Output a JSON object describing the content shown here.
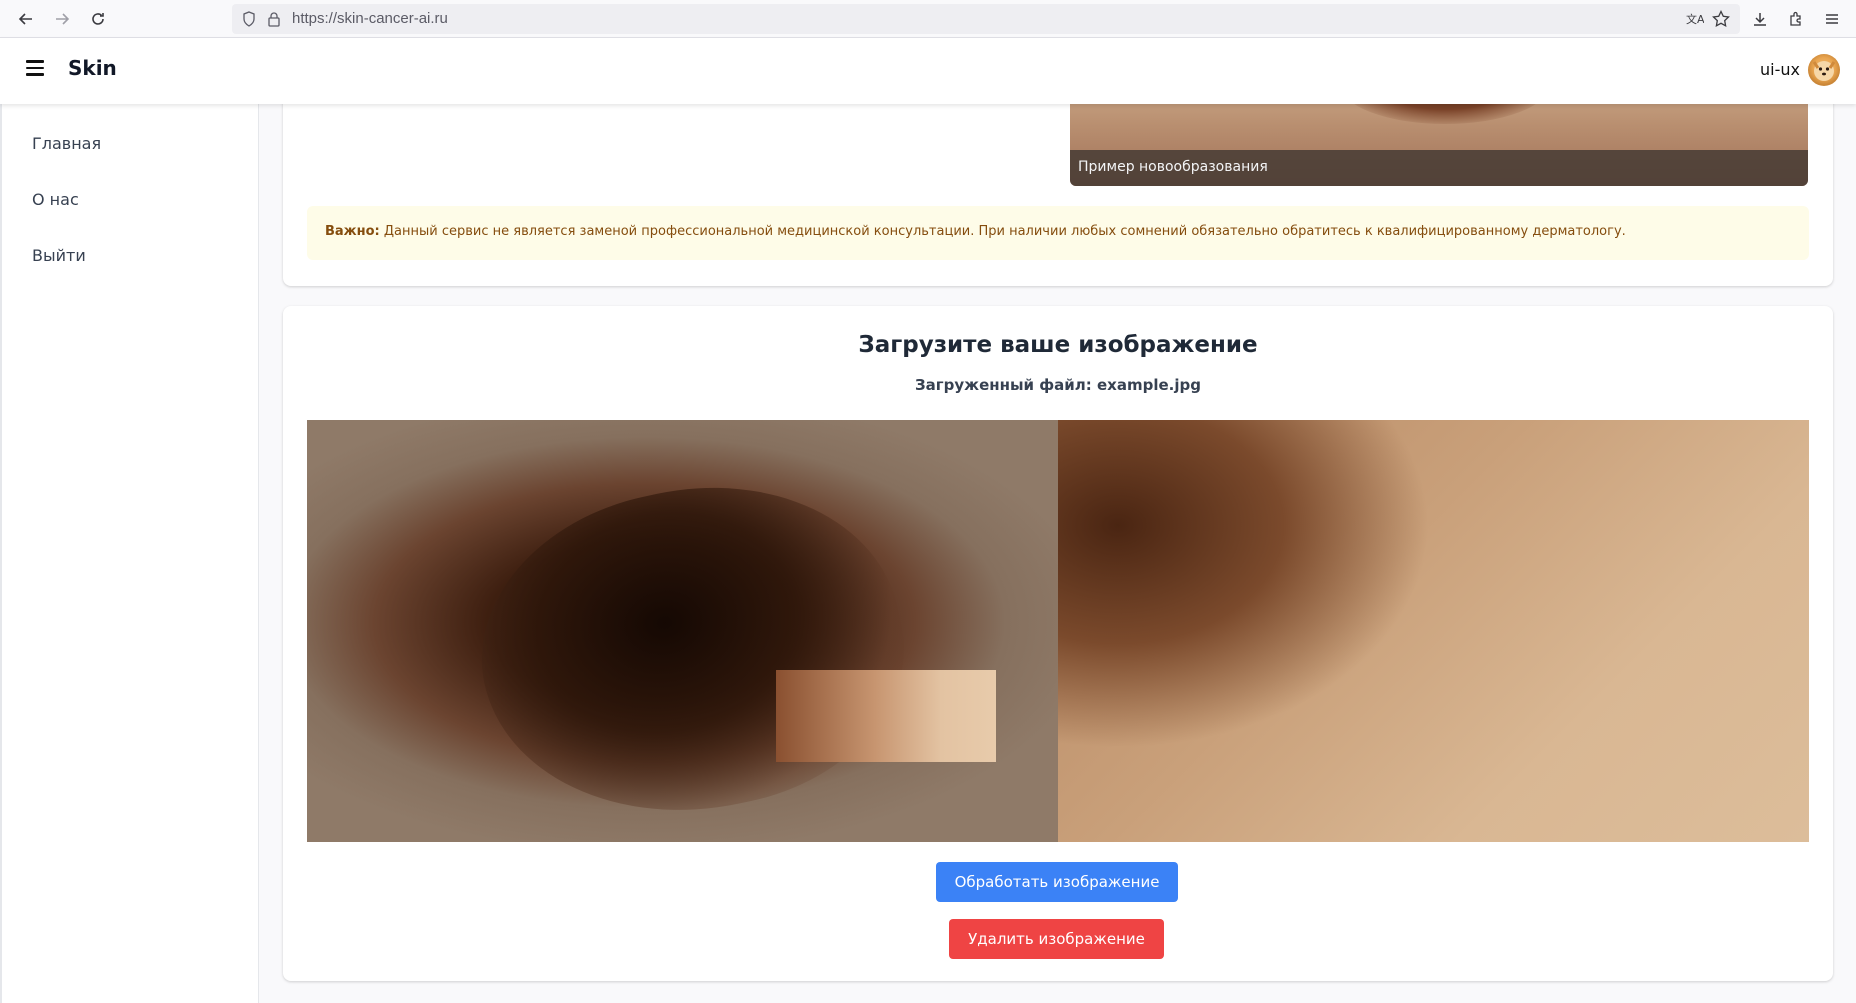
{
  "browser": {
    "url": "https://skin-cancer-ai.ru"
  },
  "header": {
    "brand": "Skin",
    "username": "ui-ux"
  },
  "sidebar": {
    "items": [
      {
        "label": "Главная"
      },
      {
        "label": "О нас"
      },
      {
        "label": "Выйти"
      }
    ]
  },
  "top_card": {
    "example_caption": "Пример новообразования",
    "warning_bold": "Важно:",
    "warning_text": " Данный сервис не является заменой профессиональной медицинской консультации. При наличии любых сомнений обязательно обратитесь к квалифицированному дерматологу."
  },
  "upload": {
    "title": "Загрузите ваше изображение",
    "file_label": "Загруженный файл: example.jpg",
    "process_button": "Обработать изображение",
    "delete_button": "Удалить изображение"
  },
  "colors": {
    "primary": "#3b82f6",
    "danger": "#ef4444",
    "warning_bg": "#fefce8",
    "warning_text": "#854d0e"
  }
}
